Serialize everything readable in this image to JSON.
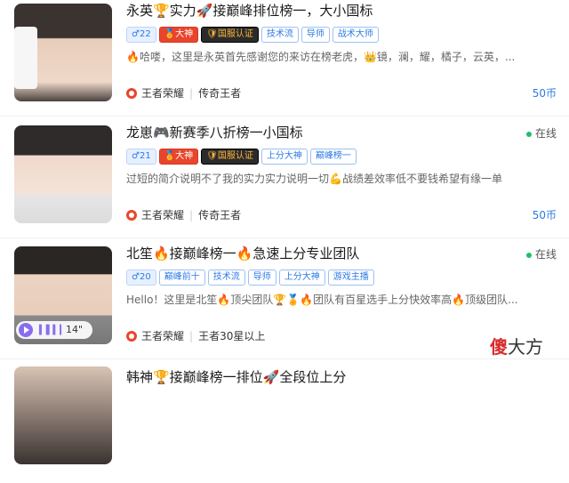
{
  "players": [
    {
      "title": "永英🏆实力🚀接巅峰排位榜一，大小国标",
      "online": "",
      "gender_level": "♂22",
      "god_tag": "🏅大神",
      "cert_tag": "🛡国服认证",
      "skills": [
        "技术流",
        "导师",
        "战术大师"
      ],
      "desc": "🔥哈喽，这里是永英首先感谢您的来访在榜老虎，👑镜，澜，耀，橘子，云英，...",
      "game": "王者荣耀",
      "rank": "传奇王者",
      "price": "50币"
    },
    {
      "title": "龙崽🎮新赛季八折榜一小国标",
      "online": "在线",
      "gender_level": "♂21",
      "god_tag": "🏅大神",
      "cert_tag": "🛡国服认证",
      "skills": [
        "上分大神",
        "巅峰榜一"
      ],
      "desc": "过短的简介说明不了我的实力实力说明一切💪战绩差效率低不要钱希望有缘一单",
      "game": "王者荣耀",
      "rank": "传奇王者",
      "price": "50币"
    },
    {
      "title": "北笙🔥接巅峰榜一🔥急速上分专业团队",
      "online": "在线",
      "gender_level": "♂20",
      "god_tag": "",
      "cert_tag": "",
      "skills": [
        "巅峰前十",
        "技术流",
        "导师",
        "上分大神",
        "游戏主播"
      ],
      "desc": "Hello！这里是北笙🔥顶尖团队🏆🏅🔥团队有百星选手上分快效率高🔥顶级团队...",
      "game": "王者荣耀",
      "rank": "王者30星以上",
      "price": "",
      "voice_duration": "14\""
    },
    {
      "title": "韩神🏆接巅峰榜一排位🚀全段位上分",
      "online": "",
      "gender_level": "",
      "god_tag": "",
      "cert_tag": "",
      "skills": [],
      "desc": "",
      "game": "",
      "rank": "",
      "price": ""
    }
  ],
  "watermark": {
    "red": "傻",
    "rest": "大方"
  },
  "colors": {
    "accent": "#2c7be5",
    "online": "#1fbf6a",
    "god": "#e9452c"
  }
}
